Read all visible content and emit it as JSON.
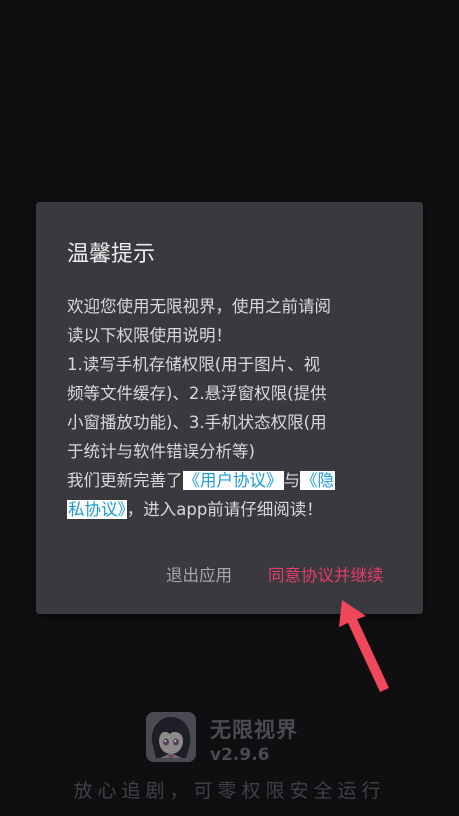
{
  "dialog": {
    "title": "温馨提示",
    "body": {
      "line1": "欢迎您使用无限视界，使用之前请阅",
      "line2": "读以下权限使用说明！",
      "line3": "1.读写手机存储权限(用于图片、视",
      "line4": "频等文件缓存)、2.悬浮窗权限(提供",
      "line5": "小窗播放功能)、3.手机状态权限(用",
      "line6": "于统计与软件错误分析等)",
      "line7_prefix": "我们更新完善了",
      "user_agreement_link": "《用户协议》",
      "conjunction": "与",
      "privacy_link_part1": "《隐",
      "privacy_link_part2": "私协议》",
      "line8_suffix": "，进入app前请仔细阅读！"
    },
    "exit_label": "退出应用",
    "agree_label": "同意协议并继续"
  },
  "splash": {
    "app_name": "无限视界",
    "version": "v2.9.6",
    "tagline": "放心追剧，可零权限安全运行"
  },
  "colors": {
    "accent_agree": "#e63d6b",
    "link": "#1a9bd8",
    "dialog_bg": "#39393e",
    "arrow": "#f0475a"
  },
  "icons": {
    "app_logo": "anime-avatar-logo",
    "annotation": "red-arrow-pointing-up-left"
  }
}
